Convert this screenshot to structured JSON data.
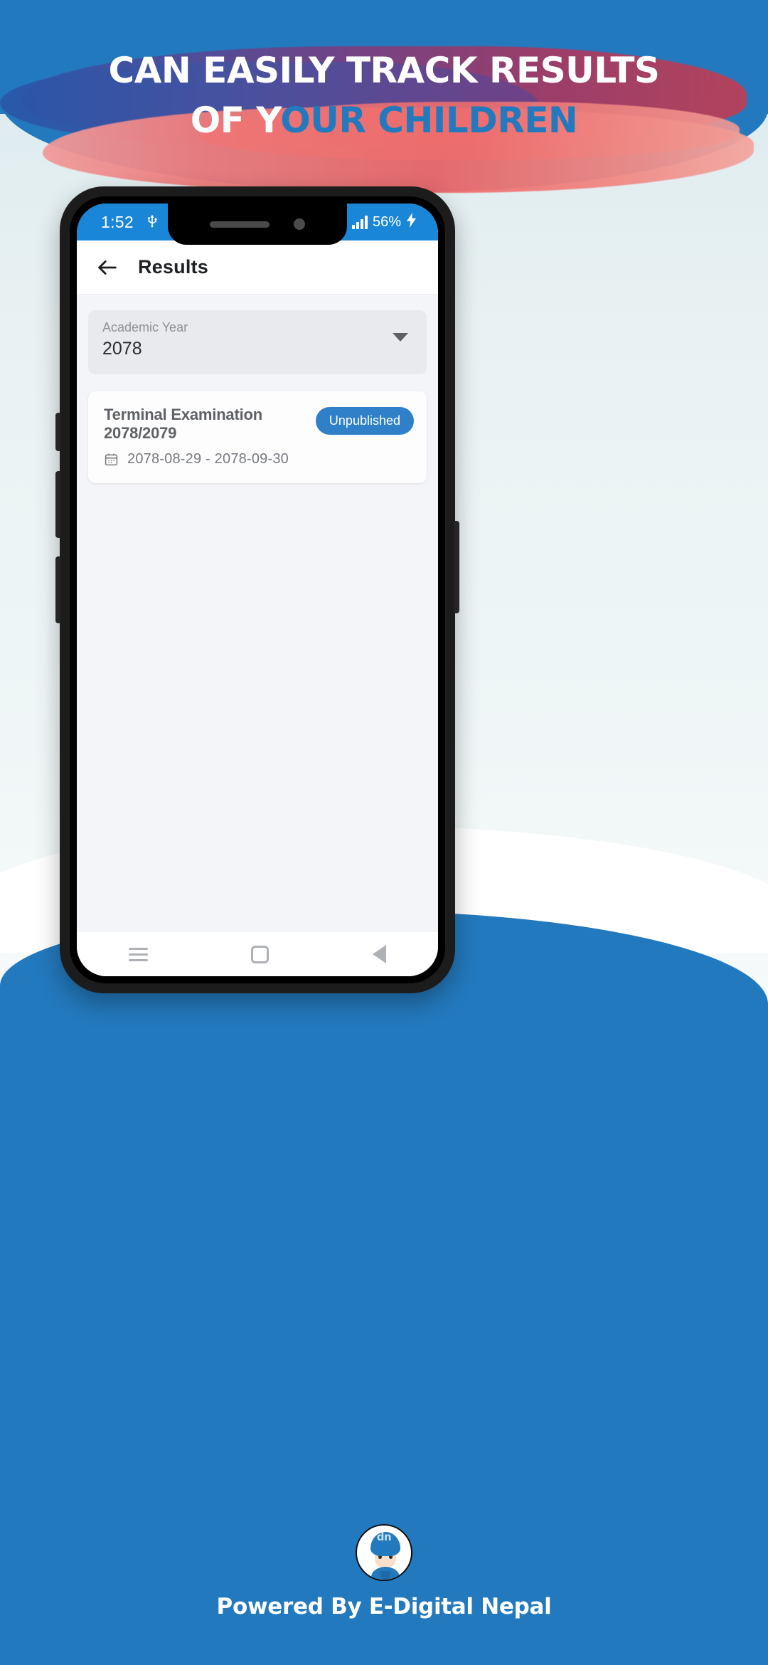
{
  "promo": {
    "line1": "CAN EASILY TRACK RESULTS",
    "line2_white": "OF Y",
    "line2_blue": "OUR CHILDREN",
    "colors": {
      "brand_blue": "#2379bd",
      "brush_red": "#ee6a6a",
      "brush_purple": "#7a3f80"
    }
  },
  "phone": {
    "status_bar": {
      "time": "1:52",
      "usb_icon": "usb-icon",
      "battery_percent": "56%",
      "charging_icon": "charging-bolt-icon",
      "signal_icon": "signal-bars-icon",
      "background_color": "#1a86d8"
    },
    "app_bar": {
      "back_icon": "back-arrow-icon",
      "title": "Results"
    },
    "academic_year_field": {
      "label": "Academic Year",
      "value": "2078",
      "dropdown_icon": "chevron-down-icon"
    },
    "results": [
      {
        "title": "Terminal Examination 2078/2079",
        "calendar_icon": "calendar-icon",
        "date_range": "2078-08-29 - 2078-09-30",
        "status_badge": "Unpublished",
        "badge_color": "#2f80c8"
      }
    ],
    "nav_bar": {
      "recents_icon": "recents-menu-icon",
      "home_icon": "home-square-icon",
      "back_icon": "back-triangle-icon"
    }
  },
  "footer": {
    "logo_icon": "e-digital-nepal-logo",
    "logo_cap_text": "dn",
    "text": "Powered By E-Digital Nepal"
  }
}
